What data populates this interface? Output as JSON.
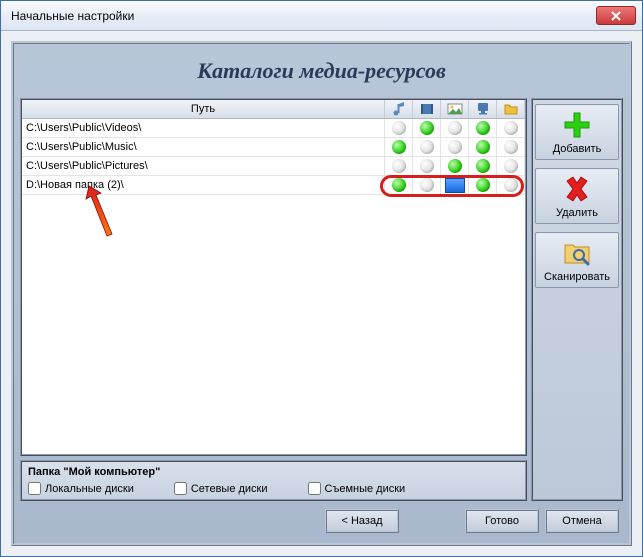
{
  "window": {
    "title": "Начальные настройки"
  },
  "header": {
    "title": "Каталоги медиа-ресурсов"
  },
  "table": {
    "header_path": "Путь",
    "rows": [
      {
        "path": "C:\\Users\\Public\\Videos\\",
        "c0": "off",
        "c1": "on",
        "c2": "off",
        "c3": "on",
        "c4": "off",
        "highlight": false
      },
      {
        "path": "C:\\Users\\Public\\Music\\",
        "c0": "on",
        "c1": "off",
        "c2": "off",
        "c3": "on",
        "c4": "off",
        "highlight": false
      },
      {
        "path": "C:\\Users\\Public\\Pictures\\",
        "c0": "off",
        "c1": "off",
        "c2": "on",
        "c3": "on",
        "c4": "off",
        "highlight": false
      },
      {
        "path": "D:\\Новая папка (2)\\",
        "c0": "on",
        "c1": "off",
        "c2": "sq",
        "c3": "on",
        "c4": "off",
        "highlight": true
      }
    ]
  },
  "bottom": {
    "title": "Папка \"Мой компьютер\"",
    "local": "Локальные диски",
    "network": "Сетевые диски",
    "removable": "Съемные диски"
  },
  "buttons": {
    "add": "Добавить",
    "delete": "Удалить",
    "scan": "Сканировать",
    "back": "< Назад",
    "finish": "Готово",
    "cancel": "Отмена"
  },
  "col_icons": [
    "music-icon",
    "video-icon",
    "image-icon",
    "stream-icon",
    "folder-icon"
  ]
}
